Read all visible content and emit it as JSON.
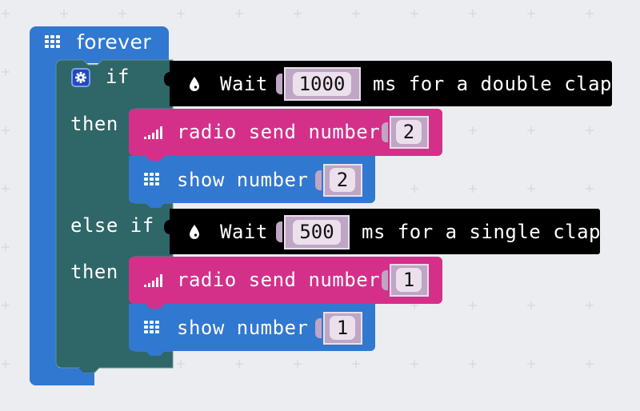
{
  "workspace": {
    "background": "#ecedf0",
    "grid_marker": "+"
  },
  "colors": {
    "basic_blue": "#3178d0",
    "logic_teal": "#2f6668",
    "radio_pink": "#d4308a",
    "extension_black": "#000000",
    "value_slot": "#bea6c4",
    "value_pill": "#ebe0ec"
  },
  "program": {
    "forever": {
      "icon": "led-grid-icon",
      "label": "forever"
    },
    "if_block": {
      "icon": "gear-icon",
      "if_label": "if",
      "then_label": "then",
      "else_if_label": "else if",
      "then2_label": "then",
      "condition1": {
        "icon": "droplet-icon",
        "label_prefix": "Wait",
        "value": "1000",
        "label_suffix": "ms for a double clap"
      },
      "branch1": [
        {
          "type": "radio",
          "icon": "signal-bars-icon",
          "label": "radio send number",
          "value": "2"
        },
        {
          "type": "show",
          "icon": "led-grid-icon",
          "label": "show number",
          "value": "2"
        }
      ],
      "condition2": {
        "icon": "droplet-icon",
        "label_prefix": "Wait",
        "value": "500",
        "label_suffix": "ms for a single clap"
      },
      "branch2": [
        {
          "type": "radio",
          "icon": "signal-bars-icon",
          "label": "radio send number",
          "value": "1"
        },
        {
          "type": "show",
          "icon": "led-grid-icon",
          "label": "show number",
          "value": "1"
        }
      ]
    }
  }
}
